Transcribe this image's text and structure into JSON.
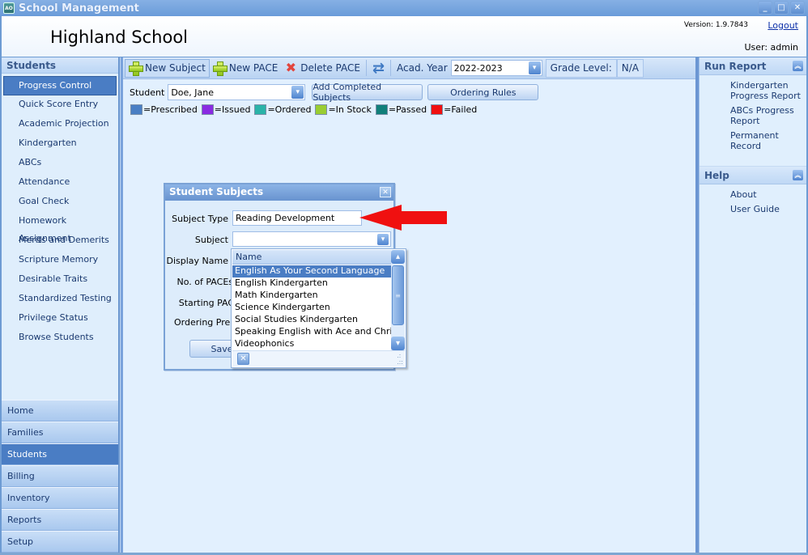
{
  "window": {
    "title": "School Management",
    "app_icon": "app-icon",
    "controls": [
      "minimize",
      "maximize",
      "close"
    ]
  },
  "header": {
    "school_name": "Highland School",
    "version": "Version: 1.9.7843",
    "logout": "Logout",
    "user": "User: admin"
  },
  "leftnav": {
    "title": "Students",
    "items": [
      {
        "label": "Progress Control",
        "active": true
      },
      {
        "label": "Quick Score Entry"
      },
      {
        "label": "Academic Projection"
      },
      {
        "label": "Kindergarten"
      },
      {
        "label": "ABCs"
      },
      {
        "label": "Attendance"
      },
      {
        "label": "Goal Check"
      },
      {
        "label": "Homework Assignment"
      },
      {
        "label": "Merits and Demerits"
      },
      {
        "label": "Scripture Memory"
      },
      {
        "label": "Desirable Traits"
      },
      {
        "label": "Standardized Testing"
      },
      {
        "label": "Privilege Status"
      },
      {
        "label": "Browse Students"
      }
    ],
    "modules": [
      {
        "label": "Home"
      },
      {
        "label": "Families"
      },
      {
        "label": "Students",
        "active": true
      },
      {
        "label": "Billing"
      },
      {
        "label": "Inventory"
      },
      {
        "label": "Reports"
      },
      {
        "label": "Setup"
      }
    ]
  },
  "toolbar": {
    "new_subject": "New Subject",
    "new_pace": "New PACE",
    "delete_pace": "Delete PACE",
    "acad_year_label": "Acad. Year",
    "acad_year_value": "2022-2023",
    "grade_level_label": "Grade Level:",
    "grade_level_value": "N/A"
  },
  "student": {
    "label": "Student",
    "value": "Doe, Jane",
    "add_completed": "Add Completed Subjects",
    "ordering_rules": "Ordering Rules"
  },
  "legend": [
    {
      "label": "=Prescribed",
      "color": "#4a7fc4"
    },
    {
      "label": "=Issued",
      "color": "#8a2be2"
    },
    {
      "label": "=Ordered",
      "color": "#2ab3a8"
    },
    {
      "label": "=In Stock",
      "color": "#9acd32"
    },
    {
      "label": "=Passed",
      "color": "#107f7a"
    },
    {
      "label": "=Failed",
      "color": "#f01010"
    }
  ],
  "rightpanel": {
    "run_report": {
      "title": "Run Report",
      "links": [
        "Kindergarten Progress Report",
        "ABCs Progress Report",
        "Permanent Record"
      ]
    },
    "help": {
      "title": "Help",
      "links": [
        "About",
        "User Guide"
      ]
    }
  },
  "dialog": {
    "title": "Student Subjects",
    "fields": {
      "subject_type_label": "Subject Type",
      "subject_type_value": "Reading Development",
      "subject_label": "Subject",
      "subject_value": "",
      "display_name_label": "Display Name",
      "num_paces_label": "No. of PACEs",
      "starting_pace_label": "Starting PACE",
      "ordering_prereq_label": "Ordering Prerequisite"
    },
    "save": "Save"
  },
  "dropdown": {
    "column_header": "Name",
    "items": [
      {
        "label": "English As Your Second Language",
        "selected": true
      },
      {
        "label": "English Kindergarten"
      },
      {
        "label": "Math Kindergarten"
      },
      {
        "label": "Science Kindergarten"
      },
      {
        "label": "Social Studies Kindergarten"
      },
      {
        "label": "Speaking English with Ace and Christi"
      },
      {
        "label": "Videophonics"
      }
    ]
  },
  "annotation": {
    "arrow_color": "#f01010"
  }
}
